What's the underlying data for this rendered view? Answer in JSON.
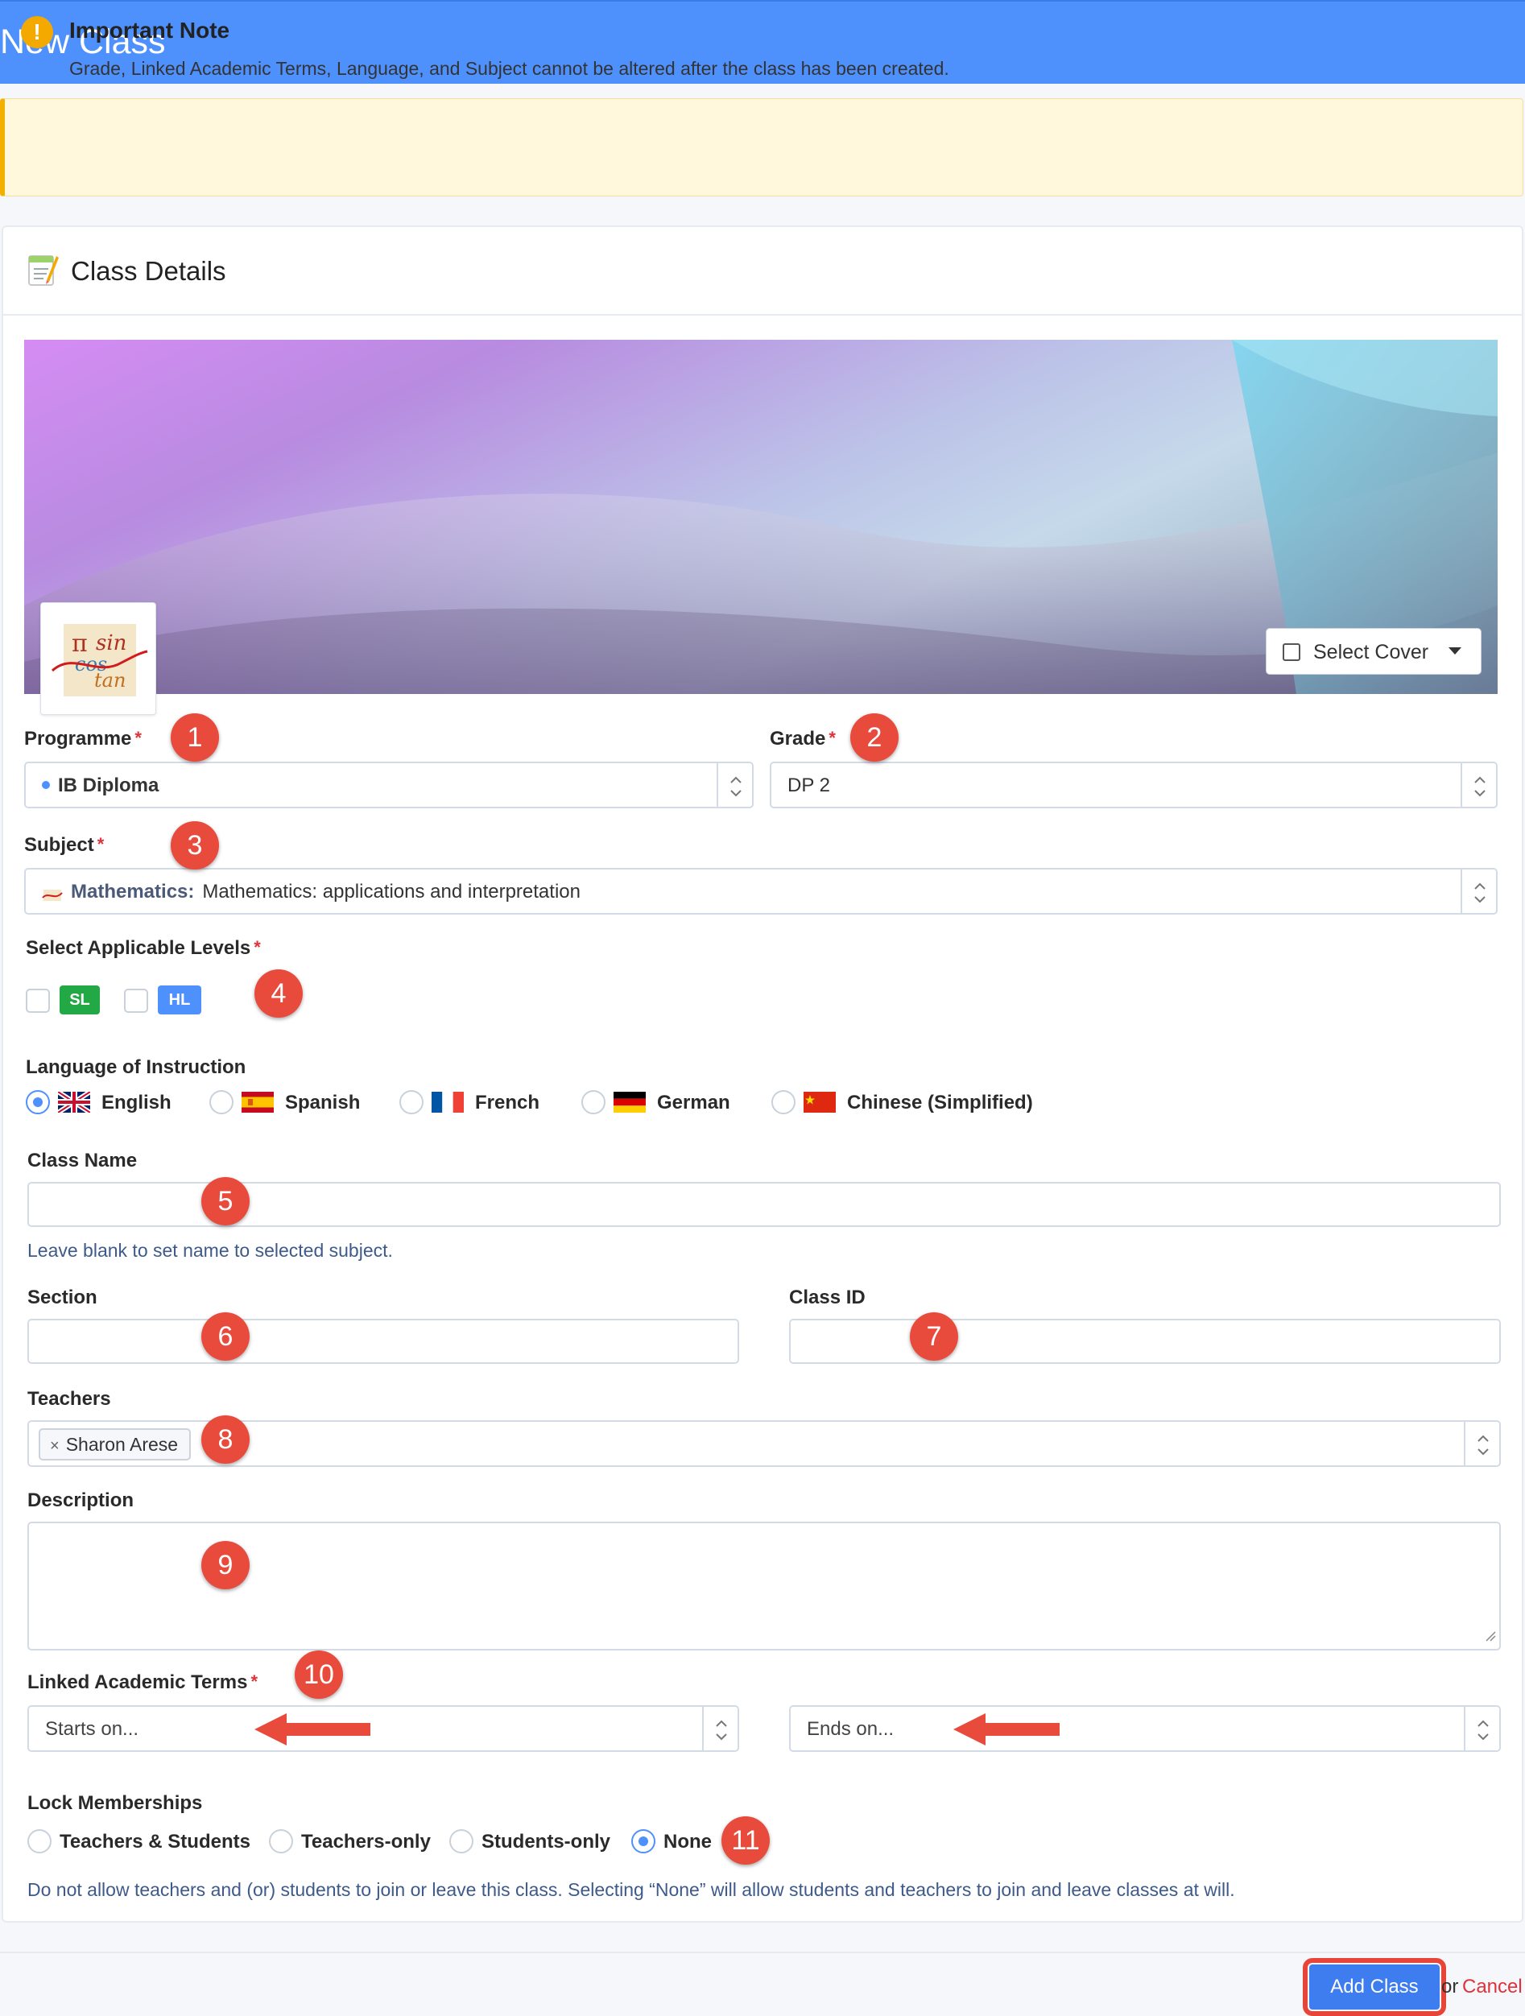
{
  "header": {
    "title": "New Class"
  },
  "note": {
    "title": "Important Note",
    "text": "Grade, Linked Academic Terms, Language, and Subject cannot be altered after the class has been created."
  },
  "card": {
    "title": "Class Details",
    "icon": "memo-icon"
  },
  "cover": {
    "select_label": "Select Cover"
  },
  "programme": {
    "label": "Programme",
    "value": "IB Diploma",
    "dot_color": "#4f91fc"
  },
  "grade": {
    "label": "Grade",
    "value": "DP 2"
  },
  "subject": {
    "label": "Subject",
    "group": "Mathematics:",
    "value": "Mathematics: applications and interpretation"
  },
  "levels": {
    "label": "Select Applicable Levels",
    "options": [
      {
        "label": "SL",
        "color": "#22a845",
        "checked": false
      },
      {
        "label": "HL",
        "color": "#4f91fc",
        "checked": false
      }
    ]
  },
  "language": {
    "label": "Language of Instruction",
    "options": [
      {
        "label": "English",
        "selected": true
      },
      {
        "label": "Spanish",
        "selected": false
      },
      {
        "label": "French",
        "selected": false
      },
      {
        "label": "German",
        "selected": false
      },
      {
        "label": "Chinese (Simplified)",
        "selected": false
      }
    ]
  },
  "class_name": {
    "label": "Class Name",
    "value": "",
    "help": "Leave blank to set name to selected subject."
  },
  "section": {
    "label": "Section",
    "value": ""
  },
  "class_id": {
    "label": "Class ID",
    "value": ""
  },
  "teachers": {
    "label": "Teachers",
    "chips": [
      "Sharon Arese"
    ]
  },
  "description": {
    "label": "Description",
    "value": ""
  },
  "terms": {
    "label": "Linked Academic Terms",
    "start_placeholder": "Starts on...",
    "end_placeholder": "Ends on..."
  },
  "lock": {
    "label": "Lock Memberships",
    "options": [
      {
        "label": "Teachers & Students",
        "selected": false
      },
      {
        "label": "Teachers-only",
        "selected": false
      },
      {
        "label": "Students-only",
        "selected": false
      },
      {
        "label": "None",
        "selected": true
      }
    ],
    "help": "Do not allow teachers and (or) students to join or leave this class. Selecting “None” will allow students and teachers to join and leave classes at will."
  },
  "markers": [
    "1",
    "2",
    "3",
    "4",
    "5",
    "6",
    "7",
    "8",
    "9",
    "10",
    "11"
  ],
  "footer": {
    "add_label": "Add Class",
    "or_text": "or",
    "cancel_label": "Cancel"
  },
  "colors": {
    "header": "#4f91fc",
    "accent": "#4f91fc",
    "required": "#e0323a",
    "marker": "#e84b3c"
  }
}
